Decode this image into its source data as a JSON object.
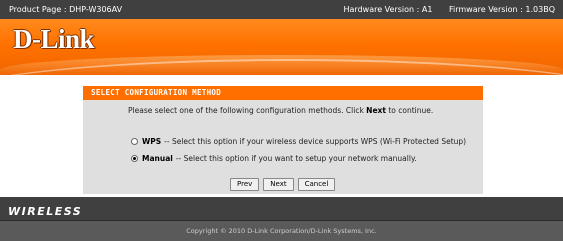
{
  "topbar": {
    "product_page": "Product Page : DHP-W306AV",
    "hardware_version": "Hardware Version : A1",
    "firmware_version": "Firmware Version : 1.03BQ"
  },
  "header": {
    "logo": "D-Link"
  },
  "panel": {
    "title": "SELECT CONFIGURATION METHOD",
    "intro_pre": "Please select one of the following configuration methods. Click ",
    "intro_bold": "Next",
    "intro_post": " to continue.",
    "options": [
      {
        "label": "WPS",
        "description": " -- Select this option if your wireless device supports WPS (Wi-Fi Protected Setup)",
        "selected": false
      },
      {
        "label": "Manual",
        "description": " -- Select this option if you want to setup your network manually.",
        "selected": true
      }
    ],
    "buttons": {
      "prev": "Prev",
      "next": "Next",
      "cancel": "Cancel"
    }
  },
  "footer": {
    "brand": "WIRELESS",
    "copyright": "Copyright © 2010 D-Link Corporation/D-Link Systems, Inc."
  },
  "colors": {
    "accent": "#ff6f00",
    "dark_bar": "#404040",
    "panel_bg": "#dfdfdf"
  }
}
